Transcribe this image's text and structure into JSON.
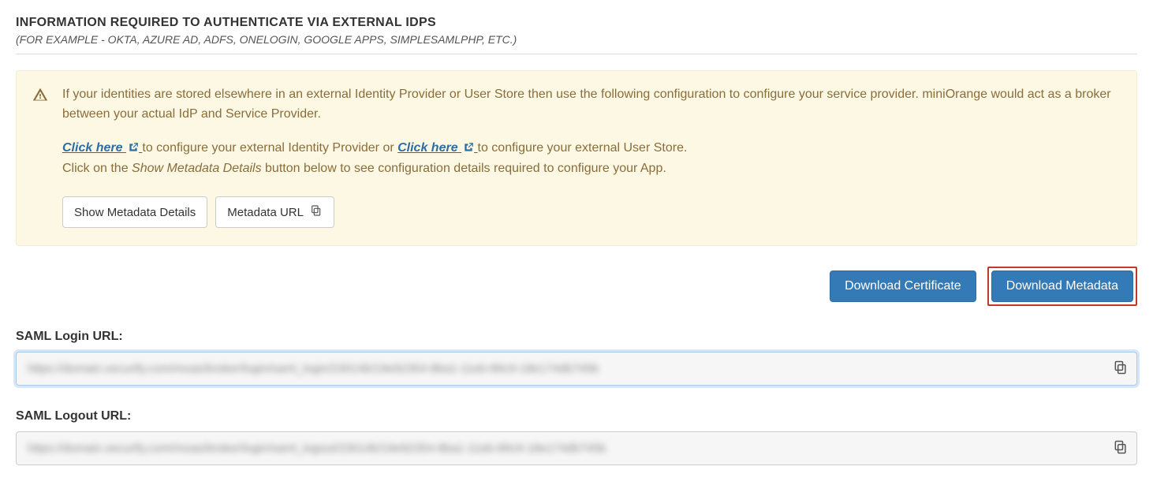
{
  "header": {
    "title": "INFORMATION REQUIRED TO AUTHENTICATE VIA EXTERNAL IDPS",
    "subtitle": "(FOR EXAMPLE - OKTA, AZURE AD, ADFS, ONELOGIN, GOOGLE APPS, SIMPLESAMLPHP, ETC.)"
  },
  "alert": {
    "line1": "If your identities are stored elsewhere in an external Identity Provider or User Store then use the following configuration to configure your service provider. miniOrange would act as a broker between your actual IdP and Service Provider.",
    "click_here_1": "Click here",
    "configure_idp_text": " to configure your external Identity Provider or ",
    "click_here_2": "Click here",
    "configure_user_store_text": " to configure your external User Store.",
    "metadata_hint_prefix": "Click on the ",
    "metadata_hint_em": "Show Metadata Details",
    "metadata_hint_suffix": " button below to see configuration details required to configure your App.",
    "show_metadata_btn": "Show Metadata Details",
    "metadata_url_btn": "Metadata URL"
  },
  "actions": {
    "download_certificate": "Download Certificate",
    "download_metadata": "Download Metadata"
  },
  "fields": {
    "saml_login": {
      "label": "SAML Login URL:",
      "value": "https://domain.xecurify.com/moas/broker/login/saml_login/23014b/19e92354-8ba1-11eb-89c9-18e174db745b"
    },
    "saml_logout": {
      "label": "SAML Logout URL:",
      "value": "https://domain.xecurify.com/moas/broker/login/saml_logout/23014b/19e92354-8ba1-11eb-89c9-18e174db745b"
    }
  }
}
